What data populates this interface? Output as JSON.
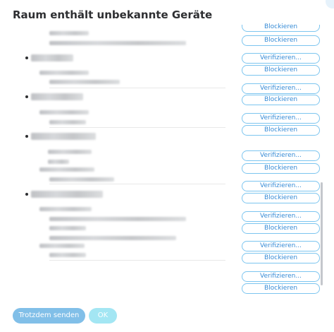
{
  "dialog": {
    "title": "Raum enthält unbekannte Geräte"
  },
  "buttons": {
    "verify_label": "Verifizieren...",
    "block_label": "Blockieren"
  },
  "footer": {
    "send_anyway_label": "Trotzdem senden",
    "ok_label": "OK"
  },
  "colors": {
    "accent": "#368bd6",
    "button_border": "#7cc5ef",
    "send_button_bg": "#81bfe8",
    "ok_button_bg": "#a3e6f3",
    "title_text": "#2e2f32"
  }
}
